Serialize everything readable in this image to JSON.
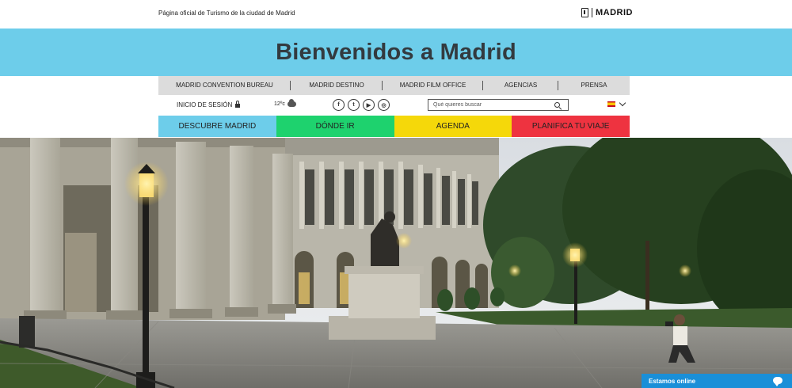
{
  "header": {
    "official_text": "Página oficial de Turismo de la ciudad de Madrid",
    "brand": "MADRID"
  },
  "banner": {
    "title": "Bienvenidos a Madrid",
    "color": "#6dcdea"
  },
  "subnav": {
    "items": [
      "MADRID CONVENTION BUREAU",
      "MADRID DESTINO",
      "MADRID FILM OFFICE",
      "AGENCIAS",
      "PRENSA"
    ]
  },
  "utility": {
    "login": "INICIO DE SESIÓN",
    "temperature": "12ºc",
    "weather_icon": "cloud-icon",
    "socials": [
      "facebook-icon",
      "twitter-icon",
      "youtube-icon",
      "instagram-icon"
    ],
    "search_placeholder": "Qué quieres buscar",
    "language_icon": "spain-flag-icon"
  },
  "mainnav": {
    "items": [
      {
        "label": "DESCUBRE MADRID",
        "color": "#6dcdea"
      },
      {
        "label": "DÓNDE IR",
        "color": "#1ed26e"
      },
      {
        "label": "AGENDA",
        "color": "#f5d80a"
      },
      {
        "label": "PLANIFICA TU VIAJE",
        "color": "#ee3340"
      }
    ]
  },
  "chat": {
    "label": "Estamos online"
  }
}
